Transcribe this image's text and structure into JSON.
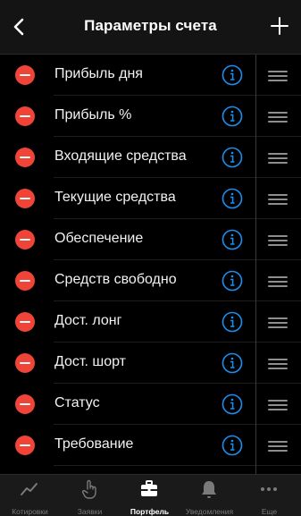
{
  "header": {
    "title": "Параметры счета",
    "back_icon": "chevron-left-icon",
    "add_icon": "plus-icon"
  },
  "rows": [
    {
      "label": "Прибыль дня"
    },
    {
      "label": "Прибыль %"
    },
    {
      "label": "Входящие средства"
    },
    {
      "label": "Текущие средства"
    },
    {
      "label": "Обеспечение"
    },
    {
      "label": "Средств свободно"
    },
    {
      "label": "Дост. лонг"
    },
    {
      "label": "Дост. шорт"
    },
    {
      "label": "Статус"
    },
    {
      "label": "Требование"
    }
  ],
  "colors": {
    "delete": "#f04438",
    "info": "#1a8ff0",
    "background": "#000000",
    "bar": "#141414"
  },
  "tabs": [
    {
      "label": "Котировки",
      "icon": "chart-line-icon",
      "active": false
    },
    {
      "label": "Заявки",
      "icon": "hand-pointer-icon",
      "active": false
    },
    {
      "label": "Портфель",
      "icon": "briefcase-icon",
      "active": true
    },
    {
      "label": "Уведомления",
      "icon": "bell-icon",
      "active": false
    },
    {
      "label": "Еще",
      "icon": "more-dots-icon",
      "active": false
    }
  ]
}
